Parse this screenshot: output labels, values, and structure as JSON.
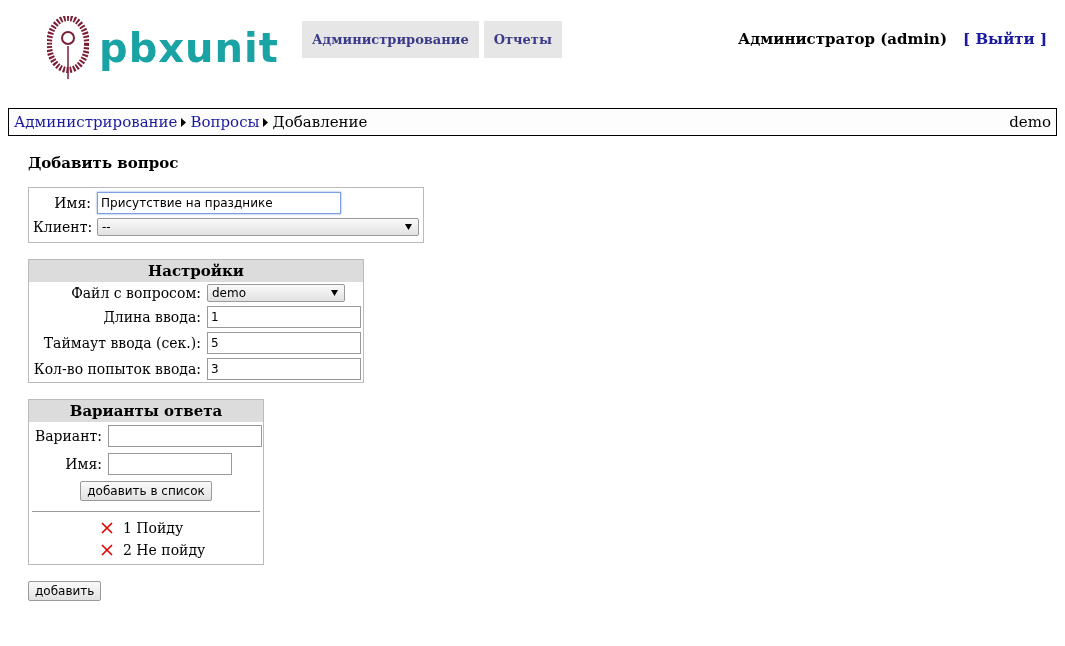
{
  "logo": {
    "text": "pbxunit"
  },
  "nav": [
    {
      "label": "Администрирование",
      "selected": false
    },
    {
      "label": "Отчеты",
      "selected": false
    }
  ],
  "user": {
    "name": "Администратор (admin)",
    "logout": "[ Выйти ]"
  },
  "breadcrumb": {
    "links": [
      "Администрирование",
      "Вопросы"
    ],
    "current": "Добавление",
    "right": "demo"
  },
  "page_title": "Добавить вопрос",
  "main_fields": [
    {
      "label": "Имя:",
      "kind": "input",
      "value": "Присутствие на празднике",
      "focused": true
    },
    {
      "label": "Клиент:",
      "kind": "select",
      "value": "--",
      "focused": false
    }
  ],
  "settings": {
    "title": "Настройки",
    "fields": [
      {
        "label": "Файл с вопросом:",
        "kind": "select",
        "value": "demo"
      },
      {
        "label": "Длина ввода:",
        "kind": "input",
        "value": "1"
      },
      {
        "label": "Таймаут ввода (сек.):",
        "kind": "input",
        "value": "5"
      },
      {
        "label": "Кол-во попыток ввода:",
        "kind": "input",
        "value": "3"
      }
    ]
  },
  "answers": {
    "title": "Варианты ответа",
    "fields": [
      {
        "label": "Вариант:"
      },
      {
        "label": "Имя:"
      }
    ],
    "add_button": "добавить в список",
    "items": [
      "1 Пойду",
      "2 Не пойду"
    ]
  },
  "submit_button": "добавить"
}
